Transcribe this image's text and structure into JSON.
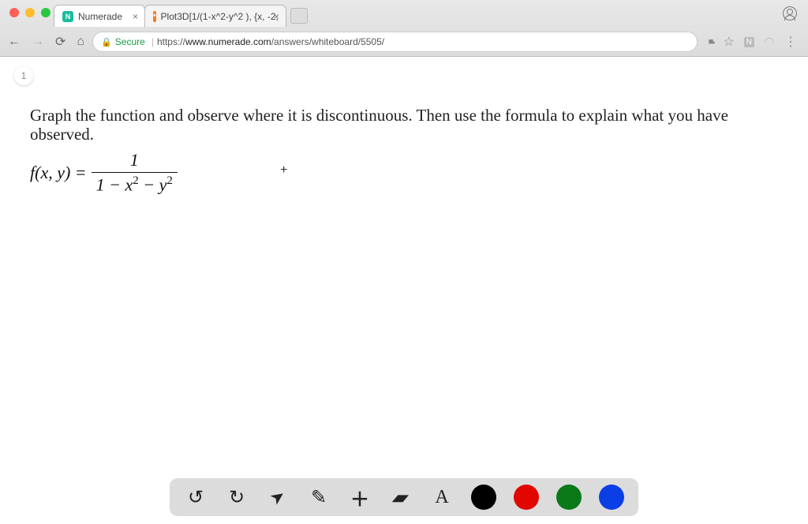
{
  "browser": {
    "tabs": [
      {
        "title": "Numerade",
        "favicon": "N",
        "active": true
      },
      {
        "title": "Plot3D[1/(1-x^2-y^2 ), {x, -2,",
        "favicon": "*",
        "active": false
      }
    ],
    "nav": {
      "back": "←",
      "forward": "→",
      "reload": "⟳",
      "home": "⌂"
    },
    "secure_label": "Secure",
    "url_prefix": "https://",
    "url_host": "www.numerade.com",
    "url_path": "/answers/whiteboard/5505/",
    "right_icons": {
      "camera": "▪▪",
      "star": "☆",
      "ext": "N",
      "menu": "⋮"
    }
  },
  "page": {
    "badge": "1",
    "question": "Graph the function and observe where it is discontinuous. Then use the formula to explain what you have observed.",
    "formula_left": "f(x, y) = ",
    "formula_num": "1",
    "formula_den_parts": {
      "one": "1",
      "minus": " − ",
      "x": "x",
      "sq": "2",
      "y": "y"
    },
    "cursor": "+"
  },
  "toolbar": {
    "undo": "↺",
    "redo": "↻",
    "pointer": "➤",
    "pencil": "✎",
    "add": "＋",
    "eraser": "▰",
    "text": "A",
    "colors": {
      "black": "#000000",
      "red": "#e10600",
      "green": "#0a7a18",
      "blue": "#0b3fe6"
    }
  }
}
